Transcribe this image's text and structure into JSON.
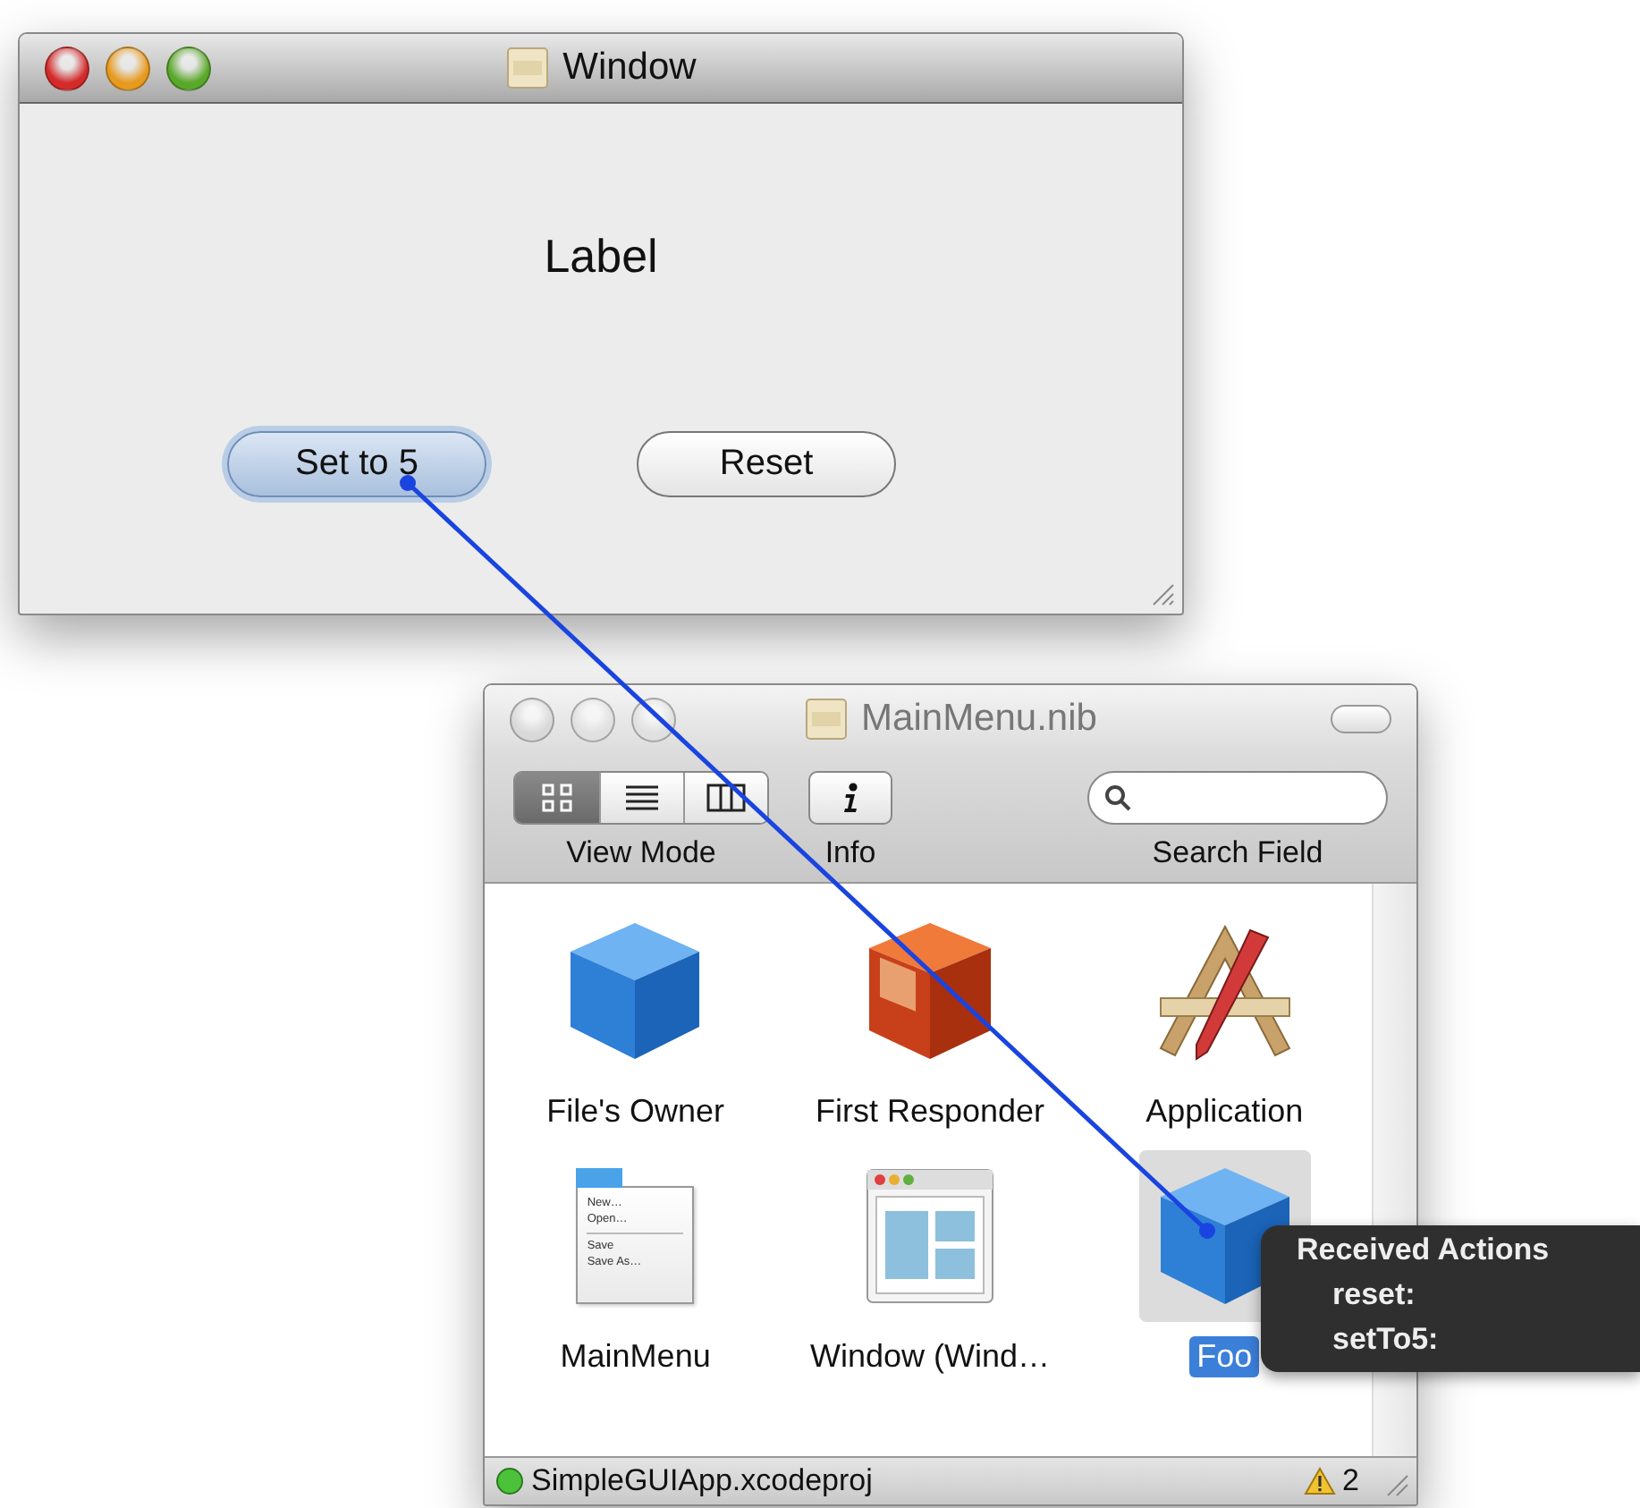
{
  "window": {
    "title": "Window",
    "label": "Label",
    "buttons": [
      {
        "label": "Set to 5",
        "selected": true
      },
      {
        "label": "Reset",
        "selected": false
      }
    ]
  },
  "nib_window": {
    "title": "MainMenu.nib",
    "toolbar": {
      "view_mode": {
        "label": "View Mode",
        "segments": [
          {
            "kind": "icons",
            "selected": true
          },
          {
            "kind": "list",
            "selected": false
          },
          {
            "kind": "columns",
            "selected": false
          }
        ]
      },
      "info": {
        "label": "Info"
      },
      "search": {
        "label": "Search Field"
      }
    },
    "items": [
      {
        "kind": "cube",
        "label": "File's Owner",
        "selected": false
      },
      {
        "kind": "responder",
        "label": "First Responder",
        "selected": false
      },
      {
        "kind": "application",
        "label": "Application",
        "selected": false
      },
      {
        "kind": "menu",
        "label": "MainMenu",
        "selected": false,
        "menu_items": [
          "New…",
          "Open…",
          "Save",
          "Save As…"
        ]
      },
      {
        "kind": "window",
        "label": "Window (Wind…",
        "selected": false
      },
      {
        "kind": "cube",
        "label": "Foo",
        "selected": true
      }
    ],
    "status_bar": {
      "project": "SimpleGUIApp.xcodeproj",
      "warnings": "2"
    }
  },
  "tooltip": {
    "title": "Received Actions",
    "actions": [
      "reset:",
      "setTo5:"
    ]
  }
}
